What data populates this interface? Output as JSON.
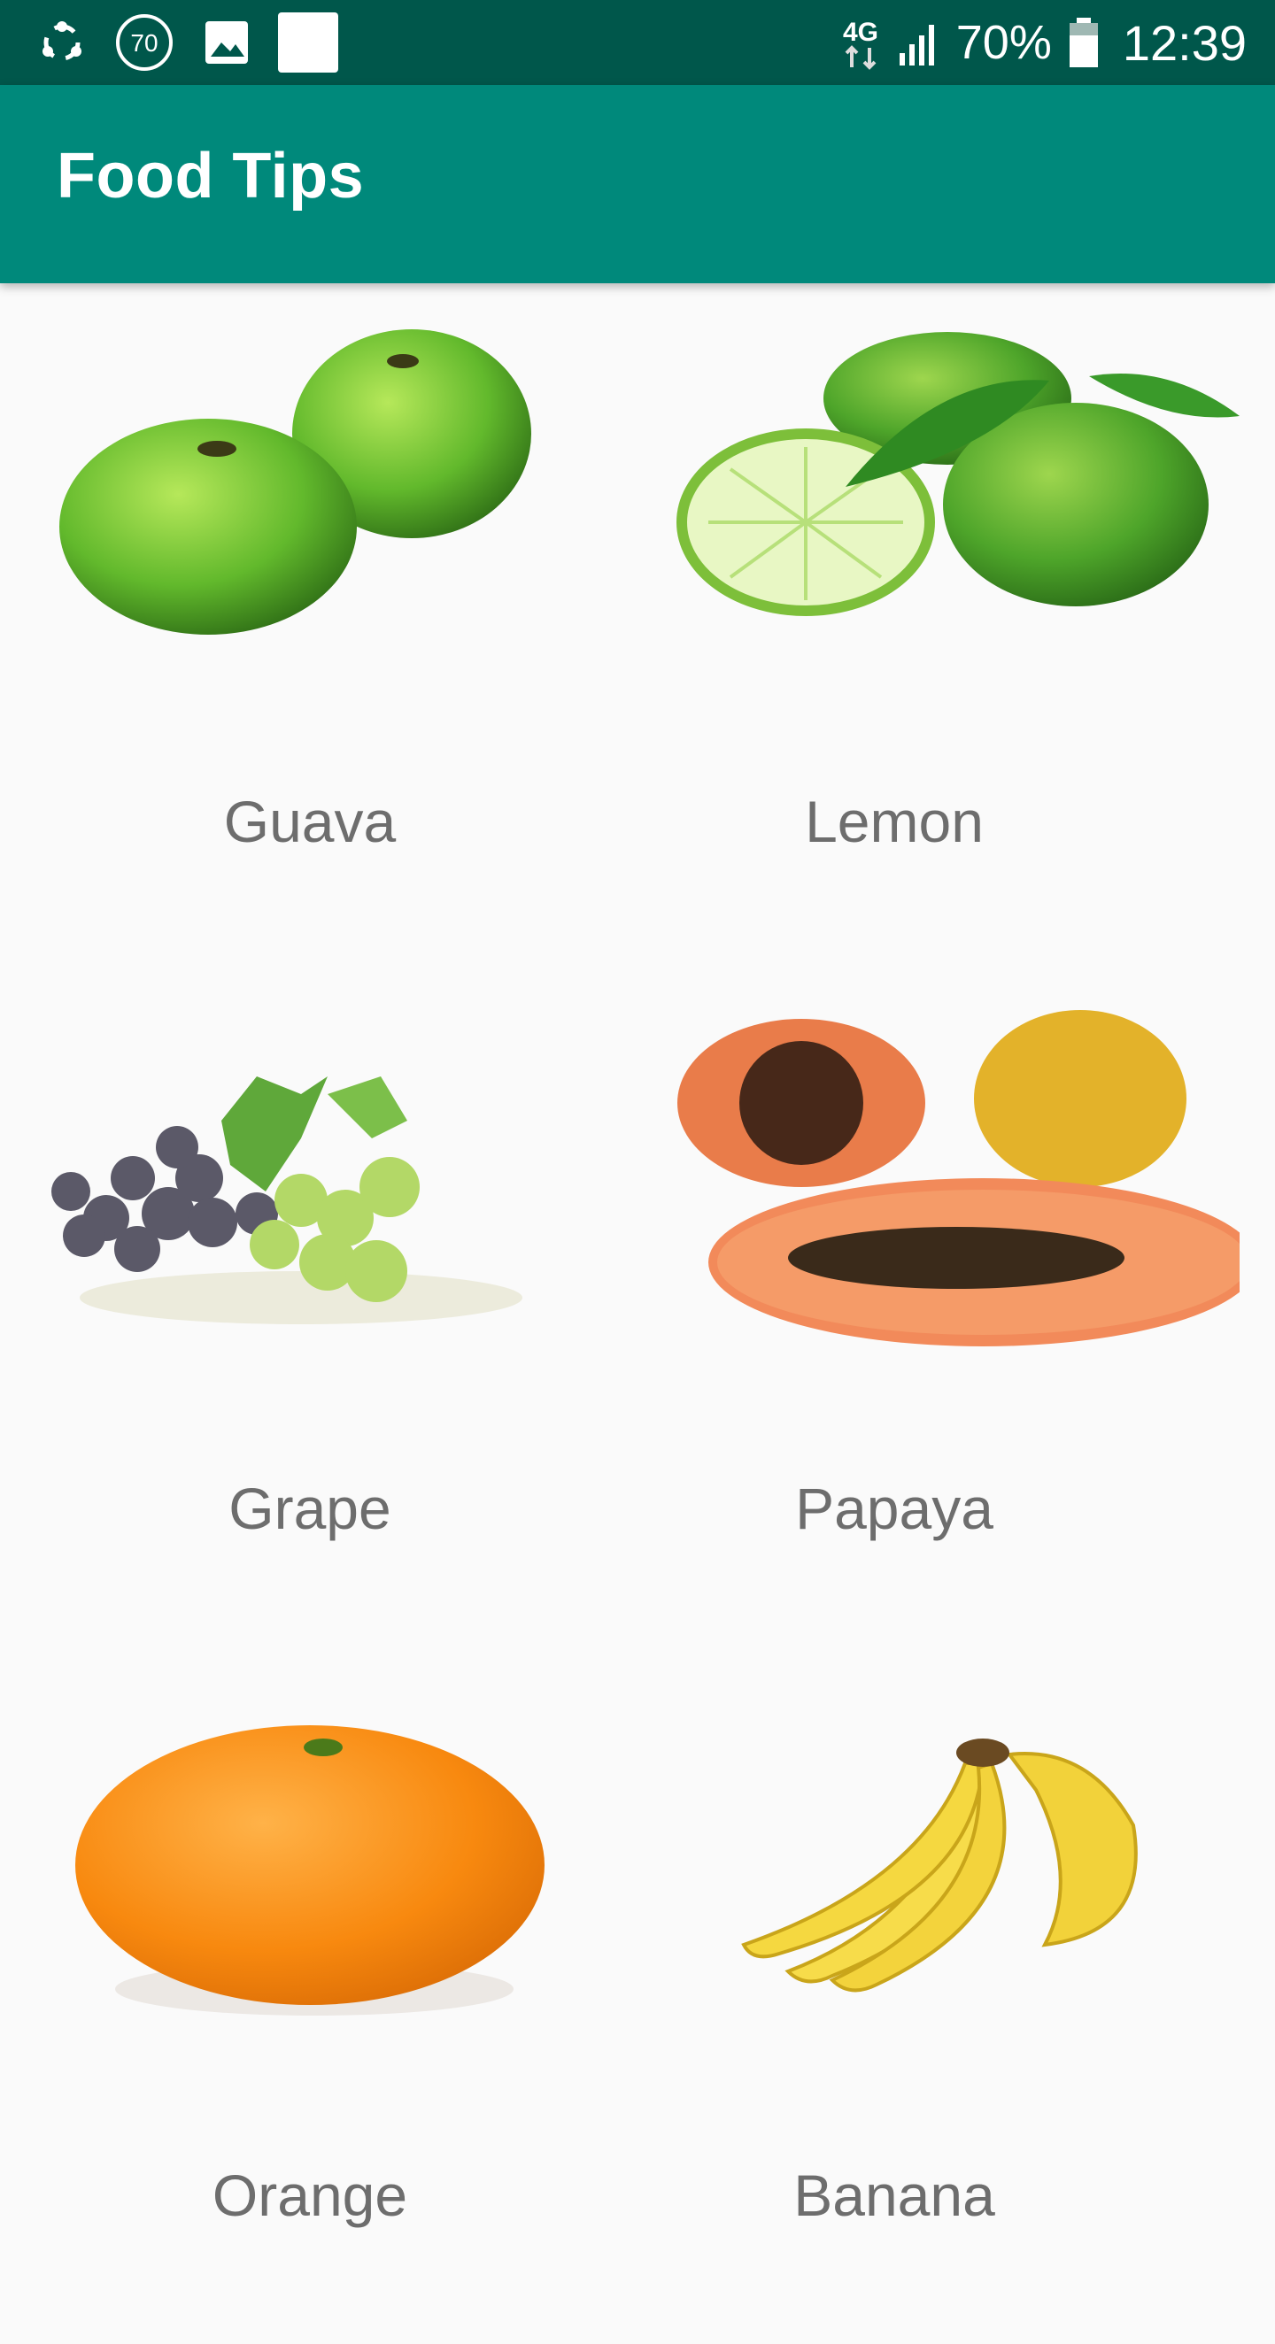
{
  "status_bar": {
    "icons_left": [
      "sync-icon",
      "badge-70-icon",
      "gallery-icon",
      "square-notification-icon"
    ],
    "badge_text": "70",
    "network_label": "4G",
    "battery_percent": "70%",
    "time": "12:39"
  },
  "app_bar": {
    "title": "Food Tips"
  },
  "grid": {
    "items": [
      {
        "label": "Guava",
        "icon": "guava-image"
      },
      {
        "label": "Lemon",
        "icon": "lemon-image"
      },
      {
        "label": "Grape",
        "icon": "grape-image"
      },
      {
        "label": "Papaya",
        "icon": "papaya-image"
      },
      {
        "label": "Orange",
        "icon": "orange-image"
      },
      {
        "label": "Banana",
        "icon": "banana-image"
      }
    ]
  },
  "colors": {
    "status_bar": "#00574b",
    "app_bar": "#00897b",
    "background": "#fafafa",
    "label_text": "#6d6d6d"
  }
}
